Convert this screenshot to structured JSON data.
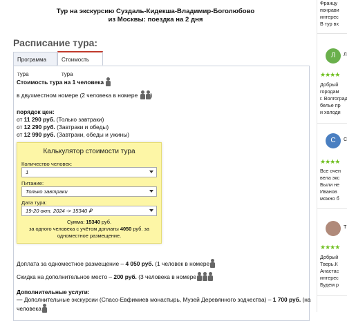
{
  "page": {
    "title_line1": "Тур на экскурсию Суздаль-Кидекша-Владимир-Боголюбово",
    "title_line2": "из Москвы: поездка на 2 дня",
    "schedule_heading": "Расписание тура:"
  },
  "tabs": [
    {
      "label": "Программа тура",
      "active": false
    },
    {
      "label": "Стоимость тура",
      "active": true
    }
  ],
  "cost": {
    "per_person_label": "Стоимость тура на 1 человека",
    "double_room_note": "в двухместном номере (2 человека в номере",
    "double_room_close": ")",
    "price_order_label": "порядок цен:",
    "prices": [
      {
        "prefix": "от",
        "amount": "11 290 руб.",
        "note": "(Только завтраки)"
      },
      {
        "prefix": "от",
        "amount": "12 290 руб.",
        "note": "(Завтраки и обеды)"
      },
      {
        "prefix": "от",
        "amount": "12 990 руб.",
        "note": "(Завтраки, обеды и ужины)"
      }
    ]
  },
  "calculator": {
    "title": "Калькулятор стоимости тура",
    "people_label": "Количество человек:",
    "people_value": "1",
    "meal_label": "Питание:",
    "meal_value": "Только завтраки",
    "date_label": "Дата тура:",
    "date_value": "19-20 окт. 2024 -> 15340 ₽",
    "sum_prefix": "Сумма:",
    "sum_value": "15340",
    "sum_unit": "руб.",
    "sum_line2a": "за одного человека с учётом доплаты",
    "sum_surcharge": "4050",
    "sum_line2b": "руб. за",
    "sum_line3": "одноместное размещение."
  },
  "extras": {
    "single_prefix": "Доплата за одноместное размещение –",
    "single_amount": "4 050 руб.",
    "single_note": "(1 человек в номере",
    "discount_prefix": "Скидка на дополнительное место –",
    "discount_amount": "200 руб.",
    "discount_note": "(3 человека в номере",
    "additional_label": "Дополнительные услуги:",
    "additional_dash": "—",
    "additional_text": "Дополнительные экскурсии (Спасо-Евфимиев монастырь, Музей Деревянного зодчества) –",
    "additional_amount": "1 700 руб.",
    "additional_tail": "(на",
    "additional_line2": "человека"
  },
  "reviews": {
    "top_lines": [
      "Францу",
      "понрави",
      "интерес",
      "В тур вх"
    ],
    "items": [
      {
        "initial": "Л",
        "avatar_color": "#6ab04c",
        "name": "Л",
        "stars": "★★★★",
        "lines": [
          "Добрый",
          "городам",
          "г. Волгоград",
          "белье пр",
          "и холоди"
        ]
      },
      {
        "initial": "С",
        "avatar_color": "#4a7fc1",
        "name": "С",
        "stars": "★★★★",
        "lines": [
          "Все очен",
          "вела экс",
          "Были не",
          "Иванов",
          "можно б"
        ]
      },
      {
        "initial": "",
        "avatar_color": "#b08a7a",
        "name": "Т",
        "stars": "★★★★",
        "lines": [
          "Добрый",
          "Тверь.К",
          "Анастас",
          "интерес",
          "Будем р"
        ]
      }
    ]
  },
  "colors": {
    "accent": "#c0392b",
    "calc_bg": "#fdf6a6",
    "stars": "#6fbf1f"
  }
}
